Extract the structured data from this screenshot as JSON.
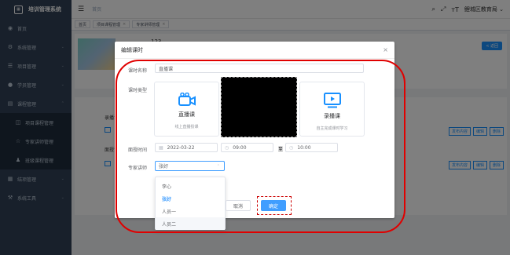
{
  "app": {
    "title": "培训管理系统",
    "logo_icon": "grid-icon"
  },
  "sidebar": {
    "items": [
      {
        "label": "首页",
        "icon": "dashboard-icon",
        "has_arrow": false
      },
      {
        "label": "系统管理",
        "icon": "gear-icon",
        "has_arrow": true
      },
      {
        "label": "项目管理",
        "icon": "list-icon",
        "has_arrow": true
      },
      {
        "label": "学员管理",
        "icon": "user-icon",
        "has_arrow": true
      },
      {
        "label": "课程管理",
        "icon": "book-icon",
        "has_arrow": true
      }
    ],
    "submenu": [
      {
        "label": "项目课程管理",
        "icon": "book-open-icon"
      },
      {
        "label": "专家讲师管理",
        "icon": "star-icon"
      },
      {
        "label": "班级课程管理",
        "icon": "users-icon"
      }
    ],
    "items_after": [
      {
        "label": "结项管理",
        "icon": "grid-icon",
        "has_arrow": true
      },
      {
        "label": "系统工具",
        "icon": "tools-icon",
        "has_arrow": true
      }
    ]
  },
  "topbar": {
    "breadcrumb": "首页",
    "user": "鲤城区教育局",
    "icons": [
      "search-icon",
      "fullscreen-icon",
      "font-size-icon"
    ]
  },
  "tags": [
    {
      "label": "首页",
      "closable": false
    },
    {
      "label": "项目课程管理",
      "closable": true
    },
    {
      "label": "专家讲师管理",
      "closable": true
    }
  ],
  "background": {
    "course_title": "123",
    "back_button": "< 返回",
    "rows": [
      {
        "title": "录播课",
        "buttons": [
          "发布内容",
          "编辑",
          "删除"
        ]
      },
      {
        "title": "面授课",
        "buttons": [
          "发布内容",
          "编辑",
          "删除"
        ]
      }
    ]
  },
  "dialog": {
    "title": "编辑课时",
    "close_icon": "close-icon",
    "name_label": "课时名称",
    "name_value": "直播课",
    "type_label": "课时类型",
    "types": [
      {
        "title": "直播课",
        "desc": "线上直播授课",
        "icon": "video-camera-icon"
      },
      {
        "title": "录播课",
        "desc": "自主完成课时学习",
        "icon": "play-screen-icon"
      }
    ],
    "time_label": "面授时间",
    "date_value": "2022-03-22",
    "start_time": "09:00",
    "to_label": "至",
    "end_time": "10:00",
    "expert_label": "专家讲师",
    "expert_value": "张好",
    "expert_options": [
      {
        "label": "李心",
        "state": "normal"
      },
      {
        "label": "张好",
        "state": "selected"
      },
      {
        "label": "人员一",
        "state": "normal"
      },
      {
        "label": "人员二",
        "state": "hover"
      }
    ],
    "cancel_label": "取消",
    "ok_label": "确定"
  },
  "colors": {
    "sidebar_bg": "#304156",
    "primary": "#409eff",
    "annotation": "#e00000"
  }
}
